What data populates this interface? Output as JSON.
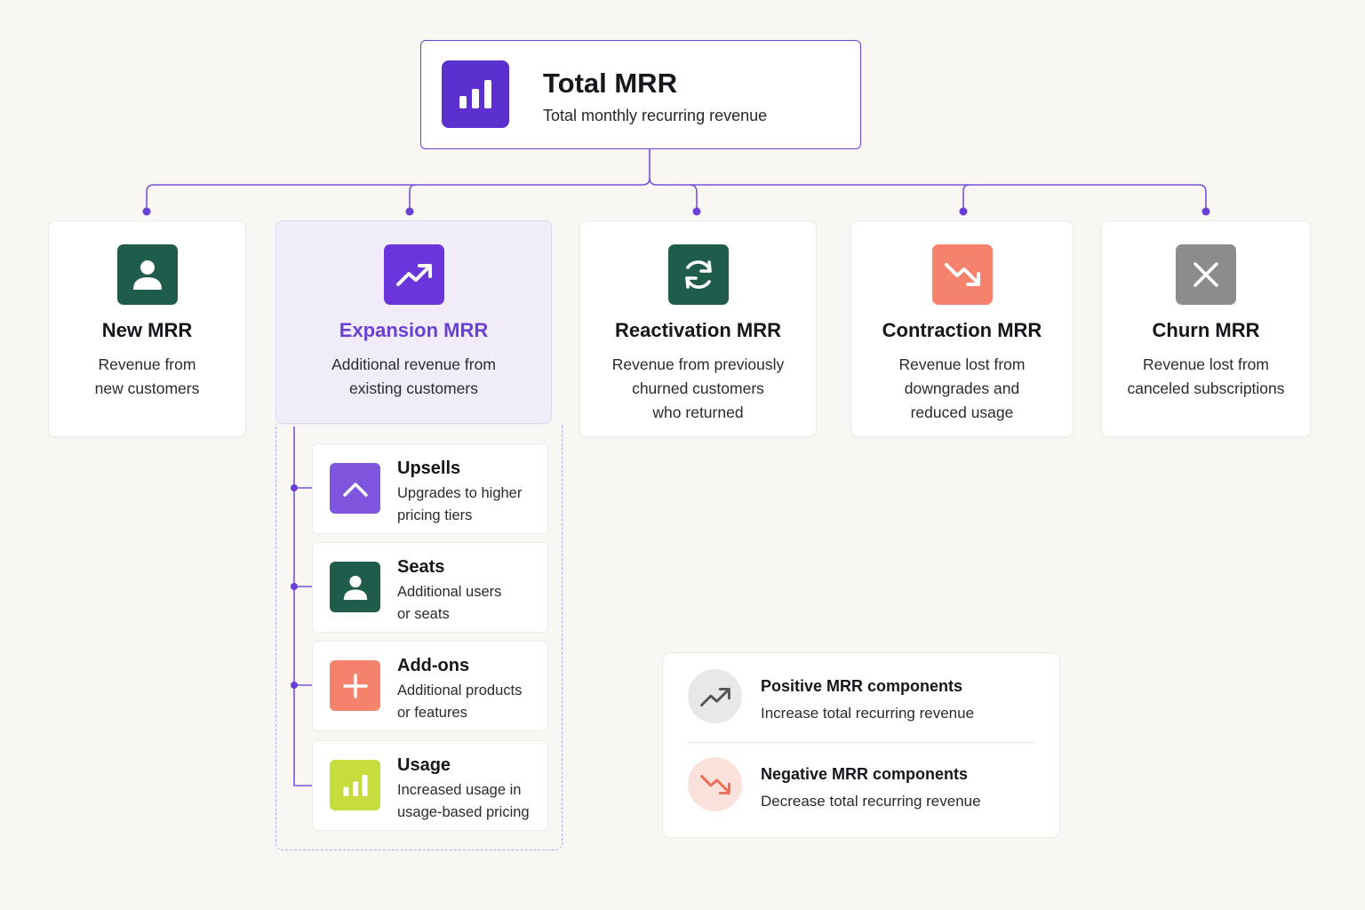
{
  "root": {
    "title": "Total MRR",
    "subtitle": "Total monthly recurring revenue",
    "icon": "bar-chart-icon",
    "color": "#5b30cf"
  },
  "components": [
    {
      "title": "New MRR",
      "description": "Revenue from\nnew customers",
      "icon": "user-icon",
      "color": "#1f5c4b"
    },
    {
      "title": "Expansion MRR",
      "description": "Additional revenue from\nexisting customers",
      "icon": "trending-up-icon",
      "color": "#6a36dc",
      "highlighted": true
    },
    {
      "title": "Reactivation MRR",
      "description": "Revenue from previously\nchurned customers\nwho returned",
      "icon": "refresh-icon",
      "color": "#1f5c4b"
    },
    {
      "title": "Contraction MRR",
      "description": "Revenue lost from\ndowngrades and\nreduced usage",
      "icon": "trending-down-icon",
      "color": "#f4826c"
    },
    {
      "title": "Churn MRR",
      "description": "Revenue lost from\ncanceled subscriptions",
      "icon": "close-icon",
      "color": "#8c8c8c"
    }
  ],
  "expansion_breakdown": [
    {
      "title": "Upsells",
      "description": "Upgrades to higher\npricing tiers",
      "icon": "chevron-up-icon",
      "color": "#7e55dc"
    },
    {
      "title": "Seats",
      "description": "Additional users\nor seats",
      "icon": "user-icon",
      "color": "#1f5c4b"
    },
    {
      "title": "Add-ons",
      "description": "Additional products\nor features",
      "icon": "plus-icon",
      "color": "#f4826c"
    },
    {
      "title": "Usage",
      "description": "Increased usage in\nusage-based pricing",
      "icon": "bar-chart-icon",
      "color": "#c5dc3c"
    }
  ],
  "legend": {
    "positive": {
      "title": "Positive MRR components",
      "description": "Increase total recurring revenue",
      "icon": "trending-up-icon",
      "color": "#e8e8e8"
    },
    "negative": {
      "title": "Negative MRR components",
      "description": "Decrease total recurring revenue",
      "icon": "trending-down-icon",
      "color": "#fbe1db"
    }
  },
  "colors": {
    "accent": "#6a3fd6",
    "connector": "#7a52d8",
    "background": "#f9f7f4"
  }
}
